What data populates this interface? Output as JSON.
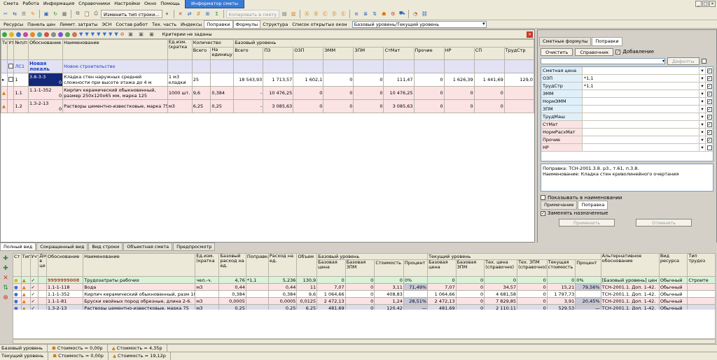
{
  "menu": {
    "items": [
      "Смета",
      "Работа",
      "Информация",
      "Справочники",
      "Настройки",
      "Окно",
      "Помощь"
    ],
    "active_tab": "Информатор сметы",
    "win_buttons": [
      "_",
      "□",
      "×"
    ]
  },
  "toolbar": {
    "change_type_label": "Изменить тип строки...",
    "copy_label": "Копировать в смету"
  },
  "nav": {
    "items": [
      "Ресурсы",
      "Панель цен",
      "Лимит. затраты",
      "ЭСН",
      "Состав работ",
      "Тех. часть",
      "Индексы",
      "Поправки",
      "Формулы",
      "Структура",
      "Список открытых окон"
    ],
    "active": "Поправки",
    "level_combo": "Базовый уровень/Текущий уровень"
  },
  "filter": {
    "criteria_text": "Критерии не заданы"
  },
  "main_grid": {
    "headers": {
      "ti": "Ти",
      "ut": "Ут",
      "no": "№п/п",
      "basis": "Обоснование",
      "name": "Наименование",
      "unit": "Ед.изм. (кратка",
      "qty_group": "Количество",
      "qty_total": "Всего",
      "qty_unit": "На единицу",
      "base_level": "Базовый уровень",
      "total": "Всего",
      "pz": "ПЗ",
      "ozp": "ОЗП",
      "emm": "ЭММ",
      "zpm": "ЗПМ",
      "stmat": "СтМат",
      "other": "Прочие",
      "nr": "НР",
      "sp": "СП",
      "trud": "ТрудСтр"
    },
    "section": {
      "no": "ЛС1",
      "basis_line1": "Новая",
      "basis_line2": "локаль",
      "name": "Новое строительство"
    },
    "rows": [
      {
        "no": "1",
        "basis": "3.8-3-3",
        "sub": "0",
        "name": "Кладка стен наружных средней сложности при высоте этажа до 4 м",
        "unit": "1 м3 кладки",
        "qty": "25",
        "per": "",
        "total": "18 543,93",
        "pz": "1 713,57",
        "ozp": "1 602,1",
        "emm": "0",
        "zpm": "0",
        "stmat": "111,47",
        "other": "0",
        "nr": "1 626,39",
        "sp": "1 441,69",
        "trud": "129,0",
        "kind": "sel"
      },
      {
        "no": "1.1",
        "basis": "1.1-1-352",
        "sub": "0",
        "name": "Кирпич керамический обыкновенный, размер 250х120х65 мм, марка 125",
        "unit": "1000 шт.",
        "qty": "9,6",
        "per": "0,384",
        "total": "-",
        "pz": "10 476,25",
        "ozp": "0",
        "emm": "0",
        "zpm": "0",
        "stmat": "10 476,25",
        "other": "0",
        "nr": "0",
        "sp": "0",
        "trud": "",
        "kind": "pink"
      },
      {
        "no": "1.2",
        "basis": "1.3-2-13",
        "sub": "0",
        "name": "Растворы цементно-известковые, марка 75",
        "unit": "м3",
        "qty": "6,25",
        "per": "0,25",
        "total": "-",
        "pz": "3 085,63",
        "ozp": "0",
        "emm": "0",
        "zpm": "0",
        "stmat": "3 085,63",
        "other": "0",
        "nr": "0",
        "sp": "0",
        "trud": "",
        "kind": "pink"
      }
    ]
  },
  "right_panel": {
    "tabs": [
      "Сметные формулы",
      "Поправки"
    ],
    "active_tab": "Поправки",
    "btn_clear": "Очистить",
    "btn_ref": "Справочник",
    "add_label": "Добавление",
    "btn_defaults": "Дефолты",
    "params": [
      {
        "name": "Сметная цена",
        "value": "",
        "checked": true,
        "color": "blue"
      },
      {
        "name": "ОЗП",
        "value": "*1,1",
        "checked": true,
        "color": "blue"
      },
      {
        "name": "ТрудСтр",
        "value": "*1,1",
        "checked": true,
        "color": "blue"
      },
      {
        "name": "ЭММ",
        "value": "",
        "checked": true,
        "color": "blue"
      },
      {
        "name": "НормЭММ",
        "value": "",
        "checked": true,
        "color": "blue"
      },
      {
        "name": "ЗПМ",
        "value": "",
        "checked": true,
        "color": "blue"
      },
      {
        "name": "ТрудМаш",
        "value": "",
        "checked": true,
        "color": "blue"
      },
      {
        "name": "СтМат",
        "value": "",
        "checked": true,
        "color": "pink"
      },
      {
        "name": "НормРасхМат",
        "value": "",
        "checked": true,
        "color": "pink"
      },
      {
        "name": "Прочие",
        "value": "",
        "checked": true,
        "color": "pink"
      },
      {
        "name": "НР",
        "value": "",
        "checked": false,
        "color": "pink"
      }
    ],
    "note_line1": "Поправка: ТСН-2001.3.8. р3., т.61, п.3.8.",
    "note_line2": "Наименование: Кладка стен криволинейного очертания",
    "show_in_name": "Показывать в наименовании",
    "subtabs": [
      "Примечание",
      "Поправка"
    ],
    "active_subtab": "Поправка",
    "replace_label": "Заменять назначенные",
    "btn_apply": "Применить",
    "btn_cancel": "Отменить"
  },
  "bottom_tabs": {
    "items": [
      "Полный вид",
      "Сокращенный вид",
      "Вид строки",
      "Объектная смета",
      "Предпросмотр"
    ],
    "active": "Полный вид"
  },
  "res_grid": {
    "headers": {
      "st": "Ст",
      "tip": "Тип",
      "ucht": "Учт",
      "dob": "Доб в це",
      "basis": "Обоснование",
      "name": "Наименование",
      "unit": "Ед.изм. (кратка",
      "base_rate": "Базовый расход на ед.",
      "corr": "Поправка",
      "rate": "Расход на ед.",
      "vol": "Объем",
      "base_group": "Базовый уровень",
      "cur_group": "Текущий уровень",
      "b_price": "Базовая цена",
      "b_zpm": "Базовая ЗПМ",
      "b_cost": "Стоимость",
      "b_pct": "Процент",
      "c_price": "Базовая цена",
      "c_zpm": "Базовая ЗПМ",
      "c_techprice": "Тех. цена (справочно)",
      "c_techzpm": "Тех. ЗПМ (справочно)",
      "c_cost": "Текущая стоимость",
      "c_pct": "Процент",
      "alt": "Альтернативное обоснование",
      "kind": "Вид ресурса",
      "labour": "Тип трудоз"
    },
    "rows": [
      {
        "basis": "9999999008",
        "name": "Трудозатраты рабочих",
        "unit": "чел.-ч.",
        "base_rate": "4,76",
        "corr": "*1,1",
        "rate": "5,236",
        "vol": "130,9",
        "b_price": "0",
        "b_zpm": "0",
        "b_cost": "0",
        "b_pct": "0%",
        "c_price": "0",
        "c_zpm": "0",
        "c_techprice": "0",
        "c_techzpm": "0",
        "c_cost": "0",
        "c_pct": "0%",
        "alt": "[Базовый уровень] цен",
        "kind": "Обычный",
        "labour": "Строите",
        "style": "green"
      },
      {
        "basis": "1.1-1-118",
        "name": "Вода",
        "unit": "м3",
        "base_rate": "0,44",
        "corr": "",
        "rate": "0,44",
        "vol": "11",
        "b_price": "7,07",
        "b_zpm": "0",
        "b_cost": "3,11",
        "b_pct": "71,49%",
        "c_price": "7,07",
        "c_zpm": "0",
        "c_techprice": "34,57",
        "c_techzpm": "0",
        "c_cost": "15,21",
        "c_pct": "79,56%",
        "alt": "ТСН-2001.1. Доп. 1-42.",
        "kind": "Обычный",
        "labour": "",
        "style": "pink"
      },
      {
        "basis": "1.1-1-352",
        "name": "Кирпич керамический обыкновенный, разм 1000 шт.",
        "unit": "",
        "base_rate": "0,384",
        "corr": "",
        "rate": "0,384",
        "vol": "9,6",
        "b_price": "1 064,66",
        "b_zpm": "0",
        "b_cost": "408,83",
        "b_pct": "",
        "c_price": "1 064,66",
        "c_zpm": "0",
        "c_techprice": "4 681,58",
        "c_techzpm": "0",
        "c_cost": "1 797,73",
        "c_pct": "",
        "alt": "ТСН-2001.1. Доп. 1-42.",
        "kind": "Обычный",
        "labour": "",
        "style": "plain"
      },
      {
        "basis": "1.1-1-81",
        "name": "Бруски хвойных пород обрезные, длина 2-6.",
        "unit": "м3",
        "base_rate": "0,0005",
        "corr": "",
        "rate": "0,0005",
        "vol": "0,0125",
        "b_price": "2 472,13",
        "b_zpm": "0",
        "b_cost": "1,24",
        "b_pct": "28,51%",
        "c_price": "2 472,13",
        "c_zpm": "0",
        "c_techprice": "7 829,85",
        "c_techzpm": "0",
        "c_cost": "3,91",
        "c_pct": "20,45%",
        "alt": "ТСН-2001.1. Доп. 1-42.",
        "kind": "Обычный",
        "labour": "",
        "style": "pink"
      },
      {
        "basis": "1.3-2-13",
        "name": "Растворы цементно-известковые, марка 75",
        "unit": "м3",
        "base_rate": "0,25",
        "corr": "",
        "rate": "0,25",
        "vol": "6,25",
        "b_price": "481,69",
        "b_zpm": "0",
        "b_cost": "120,42",
        "b_pct": "—",
        "c_price": "481,69",
        "c_zpm": "0",
        "c_techprice": "2 110,11",
        "c_techzpm": "0",
        "c_cost": "529,53",
        "c_pct": "—",
        "alt": "ТСН-2001.1. Доп. 1-42.",
        "kind": "Обычный",
        "labour": "",
        "style": "sel"
      }
    ]
  },
  "status": {
    "base": {
      "label": "Базовый уровень",
      "cost1": "Стоимость = 0,00р",
      "cost2": "Стоимость = 4,35р"
    },
    "current": {
      "label": "Текущий уровень",
      "cost1": "Стоимость = 0,00р",
      "cost2": "Стоимость = 19,12р"
    }
  },
  "colors": {
    "accent": "#3a7bd5",
    "selected": "#14287a",
    "section": "#e2e2f4",
    "pink": "#fbe3e3",
    "green": "#d8f3d8"
  }
}
